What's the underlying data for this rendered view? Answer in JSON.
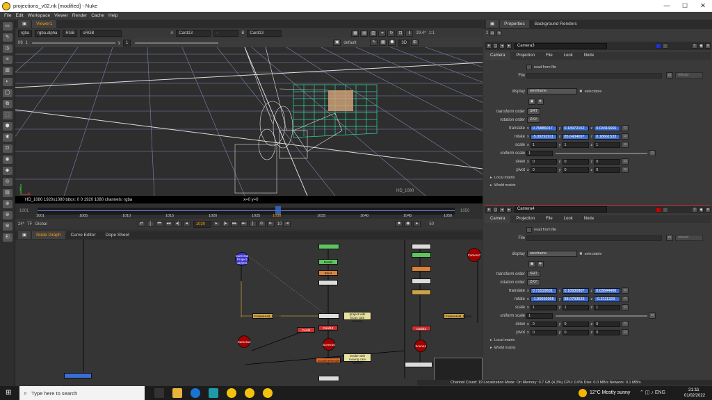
{
  "window": {
    "title": "projections_v02.nk [modified] - Nuke",
    "minimize": "—",
    "maximize": "☐",
    "close": "✕"
  },
  "menu": [
    "File",
    "Edit",
    "Workspace",
    "Viewer",
    "Render",
    "Cache",
    "Help"
  ],
  "viewer": {
    "tab": "Viewer1",
    "channels": "rgba",
    "alpha": "rgba.alpha",
    "colorspace": "RGB",
    "lut": "sRGB",
    "a_label": "A",
    "a_input": "Card13",
    "b_label": "B",
    "b_input": "Card13",
    "mid_input": "-",
    "zoom": "29.4*",
    "ratio": "1:1",
    "frame_field": "f/8",
    "frame_num": "1",
    "y_label": "y",
    "y_value": "1",
    "cam_default": "default",
    "view_mode": "3D",
    "status_left": "HD_1080 1920x1080  bbox: 0 0 1920 1080 channels: rgba",
    "status_mid": "x=0 y=0",
    "format_overlay": "HD_1080"
  },
  "timeline": {
    "start": "1001",
    "end": "1050",
    "current": "1030",
    "ticks": [
      "1001",
      "1005",
      "1010",
      "1015",
      "1020",
      "1025",
      "1030",
      "1035",
      "1040",
      "1045",
      "1050"
    ],
    "fps": "24*",
    "tf": "TF",
    "global": "Global",
    "frame_box": "1030",
    "step": "10",
    "end_box": "50",
    "start_box": "1001"
  },
  "nodegraph": {
    "tabs": [
      "Node Graph",
      "Curve Editor",
      "Dope Sheet"
    ],
    "nodes": {
      "camera3": "Camera3\nProject camera",
      "camera4": "Camera4",
      "camera7": "Camera7",
      "scene10": "Scene10",
      "scene4": "Scene4",
      "card8": "Card8",
      "card13": "Card13",
      "card11": "Card11",
      "roto": "RotoB",
      "blur": "Blur4",
      "frameholdA": "FrameHold_Frame",
      "frameholdB": "FrameHold_Frame",
      "scanline": "ScanlineRender23",
      "note1": "project with focus\ncam camera",
      "note2": "render with moving\ncam camera"
    }
  },
  "properties": {
    "tabs": [
      "Properties",
      "Background Renders"
    ],
    "panels": [
      {
        "name": "Camera3",
        "subtabs": [
          "Camera",
          "Projection",
          "File",
          "Look",
          "Node"
        ],
        "read_from_file": "read from file",
        "file_label": "File",
        "reload": "reload",
        "display_label": "display",
        "display": "wireframe",
        "selectable": "selectable",
        "transform_order_label": "transform order",
        "transform_order": "SRT",
        "rotation_order_label": "rotation order",
        "rotation_order": "ZXY",
        "translate": [
          "0.75886017",
          "0.18972152",
          "0.03416666"
        ],
        "rotate": [
          "-5.09292911",
          "85.6434097",
          "0.18661533"
        ],
        "scale": [
          "1",
          "1",
          "1"
        ],
        "uniform_scale": "1",
        "skew": [
          "0",
          "0",
          "0"
        ],
        "pivot": [
          "0",
          "0",
          "0"
        ],
        "local_matrix": "Local matrix",
        "world_matrix": "World matrix"
      },
      {
        "name": "Camera4",
        "subtabs": [
          "Camera",
          "Projection",
          "File",
          "Look",
          "Node"
        ],
        "read_from_file": "read from file",
        "file_label": "File",
        "reload": "reload",
        "display_label": "display",
        "display": "wireframe",
        "selectable": "selectable",
        "transform_order_label": "transform order",
        "transform_order": "SRT",
        "rotation_order_label": "rotation order",
        "rotation_order": "ZXY",
        "translate": [
          "0.71519691",
          "0.18930967",
          "0.03644406"
        ],
        "rotate": [
          "-1.90666056",
          "88.0793533",
          "-0.2111329"
        ],
        "scale": [
          "1",
          "1",
          "1"
        ],
        "uniform_scale": "1",
        "skew": [
          "0",
          "0",
          "0"
        ],
        "pivot": [
          "0",
          "0",
          "0"
        ],
        "local_matrix": "Local matrix",
        "world_matrix": "World matrix"
      }
    ],
    "knob_labels": {
      "translate": "translate",
      "rotate": "rotate",
      "scale": "scale",
      "uniform": "uniform scale",
      "skew": "skew",
      "pivot": "pivot"
    },
    "axes": [
      "x",
      "y",
      "z"
    ]
  },
  "status": "Channel Count: 19  Localization Mode: On  Memory: 0.7 GB (4.3%)  CPU: 0.0%  Disk: 0.0 MB/s  Network: 0.1 MB/s",
  "taskbar": {
    "search_placeholder": "Type here to search",
    "weather": "12°C  Mostly sunny",
    "time": "21:11",
    "date": "01/02/2022"
  },
  "colors": {
    "accent": "#ff9a00",
    "selected": "#3a6ed6",
    "node_red": "#b00000",
    "wireframe_green": "#2fd49a"
  }
}
